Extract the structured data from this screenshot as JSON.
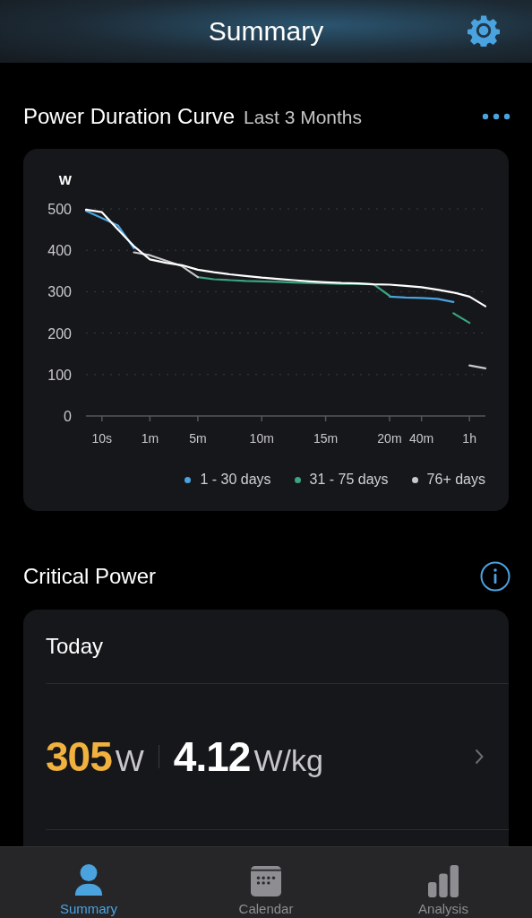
{
  "header": {
    "title": "Summary"
  },
  "power_curve": {
    "title": "Power Duration Curve",
    "subtitle": "Last 3 Months",
    "chart_data": {
      "type": "line",
      "ylabel": "W",
      "categories": [
        null,
        "10s",
        null,
        null,
        "1m",
        null,
        null,
        "5m",
        null,
        null,
        null,
        "10m",
        null,
        null,
        null,
        "15m",
        null,
        null,
        null,
        "20m",
        null,
        "40m",
        null,
        null,
        "1h",
        null
      ],
      "ylim": [
        0,
        500
      ],
      "grid": true,
      "legend": "bottom-right",
      "yticks": [
        0,
        100,
        200,
        300,
        400,
        500
      ],
      "series": [
        {
          "name": "1 - 30 days",
          "color": "#4aa3df",
          "values": [
            495,
            478,
            460,
            405,
            null,
            null,
            null,
            null,
            null,
            null,
            null,
            null,
            null,
            null,
            null,
            null,
            null,
            null,
            null,
            288,
            286,
            285,
            283,
            275,
            null,
            null
          ]
        },
        {
          "name": "31 - 75 days",
          "color": "#3aa57e",
          "values": [
            null,
            null,
            null,
            null,
            null,
            null,
            null,
            335,
            330,
            328,
            326,
            325,
            324,
            322,
            321,
            320,
            319,
            319,
            318,
            290,
            null,
            null,
            null,
            248,
            225,
            null
          ]
        },
        {
          "name": "76+ days",
          "color": "#c8c8c8",
          "values": [
            null,
            null,
            null,
            395,
            388,
            375,
            362,
            335,
            null,
            null,
            null,
            null,
            null,
            null,
            null,
            null,
            null,
            null,
            null,
            null,
            null,
            null,
            null,
            null,
            122,
            115
          ]
        },
        {
          "color": "#ffffff",
          "values": [
            498,
            492,
            450,
            410,
            378,
            370,
            364,
            353,
            347,
            342,
            338,
            334,
            331,
            328,
            325,
            323,
            321,
            320,
            318,
            317,
            314,
            311,
            305,
            298,
            288,
            265
          ]
        }
      ]
    }
  },
  "critical_power": {
    "title": "Critical Power",
    "period": "Today",
    "power_value": "305",
    "power_unit": "W",
    "relative_value": "4.12",
    "relative_unit": "W/kg"
  },
  "tabs": [
    {
      "label": "Summary",
      "selected": true,
      "kind": "person"
    },
    {
      "label": "Calendar",
      "selected": false,
      "kind": "calendar"
    },
    {
      "label": "Analysis",
      "selected": false,
      "kind": "bars"
    }
  ]
}
